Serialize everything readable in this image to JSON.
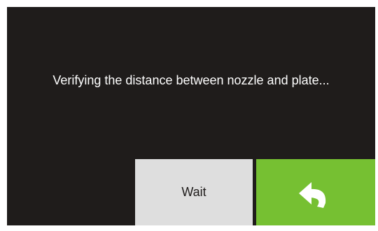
{
  "dialog": {
    "message": "Verifying the distance between nozzle and plate...",
    "wait_label": "Wait",
    "back_icon": "return-arrow-icon"
  },
  "colors": {
    "background": "#1f1c1b",
    "text": "#ffffff",
    "wait_button": "#dedede",
    "back_button": "#76c032"
  }
}
